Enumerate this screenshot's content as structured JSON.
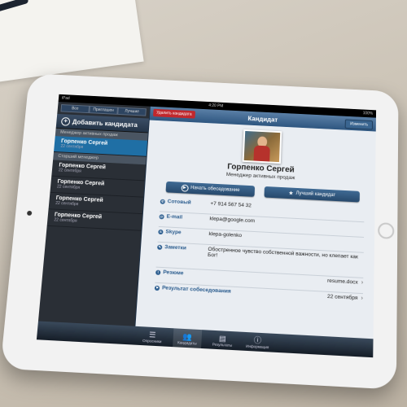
{
  "statusbar": {
    "left": "iPad",
    "time": "4:20 PM",
    "battery": "100%"
  },
  "sidebar": {
    "segments": [
      "Все",
      "Приглашен",
      "Лучшие"
    ],
    "add_label": "Добавить кандидата",
    "groups": [
      {
        "title": "Менеджер активных продаж",
        "items": [
          {
            "name": "Горпенко Сергей",
            "date": "22 сентября"
          }
        ]
      },
      {
        "title": "Старший менеджер",
        "items": [
          {
            "name": "Горпенко Сергей",
            "date": "22 сентября"
          },
          {
            "name": "Горпенко Сергей",
            "date": "22 сентября"
          },
          {
            "name": "Горпенко Сергей",
            "date": "22 сентября"
          },
          {
            "name": "Горпенко Сергей",
            "date": "22 сентября"
          }
        ]
      }
    ]
  },
  "navbar": {
    "title": "Кандидат",
    "delete_label": "Удалить кандидата",
    "edit_label": "Изменить"
  },
  "candidate": {
    "name": "Горпенко Сергей",
    "position": "Менеджер активных продаж",
    "start_interview_label": "Начать обеседование",
    "best_candidate_label": "Лучший кандидат",
    "fields": [
      {
        "icon": "phone-icon",
        "label": "Сотовый",
        "value": "+7 914 567 54 32"
      },
      {
        "icon": "email-icon",
        "label": "E-mail",
        "value": "klepa@google.com"
      },
      {
        "icon": "skype-icon",
        "label": "Skype",
        "value": "klepa-golenko"
      },
      {
        "icon": "notes-icon",
        "label": "Заметки",
        "value": "Обостренное чувство собственной важности, но клепает как Бог!"
      }
    ],
    "resume": {
      "label": "Резюме",
      "value": "resume.docx"
    },
    "result": {
      "label": "Результат собеседования",
      "value": "22 сентября"
    }
  },
  "tabbar": [
    {
      "label": "Опросники",
      "icon": "list-icon"
    },
    {
      "label": "Кандидаты",
      "icon": "people-icon"
    },
    {
      "label": "Результаты",
      "icon": "results-icon"
    },
    {
      "label": "Информация",
      "icon": "info-icon"
    }
  ]
}
